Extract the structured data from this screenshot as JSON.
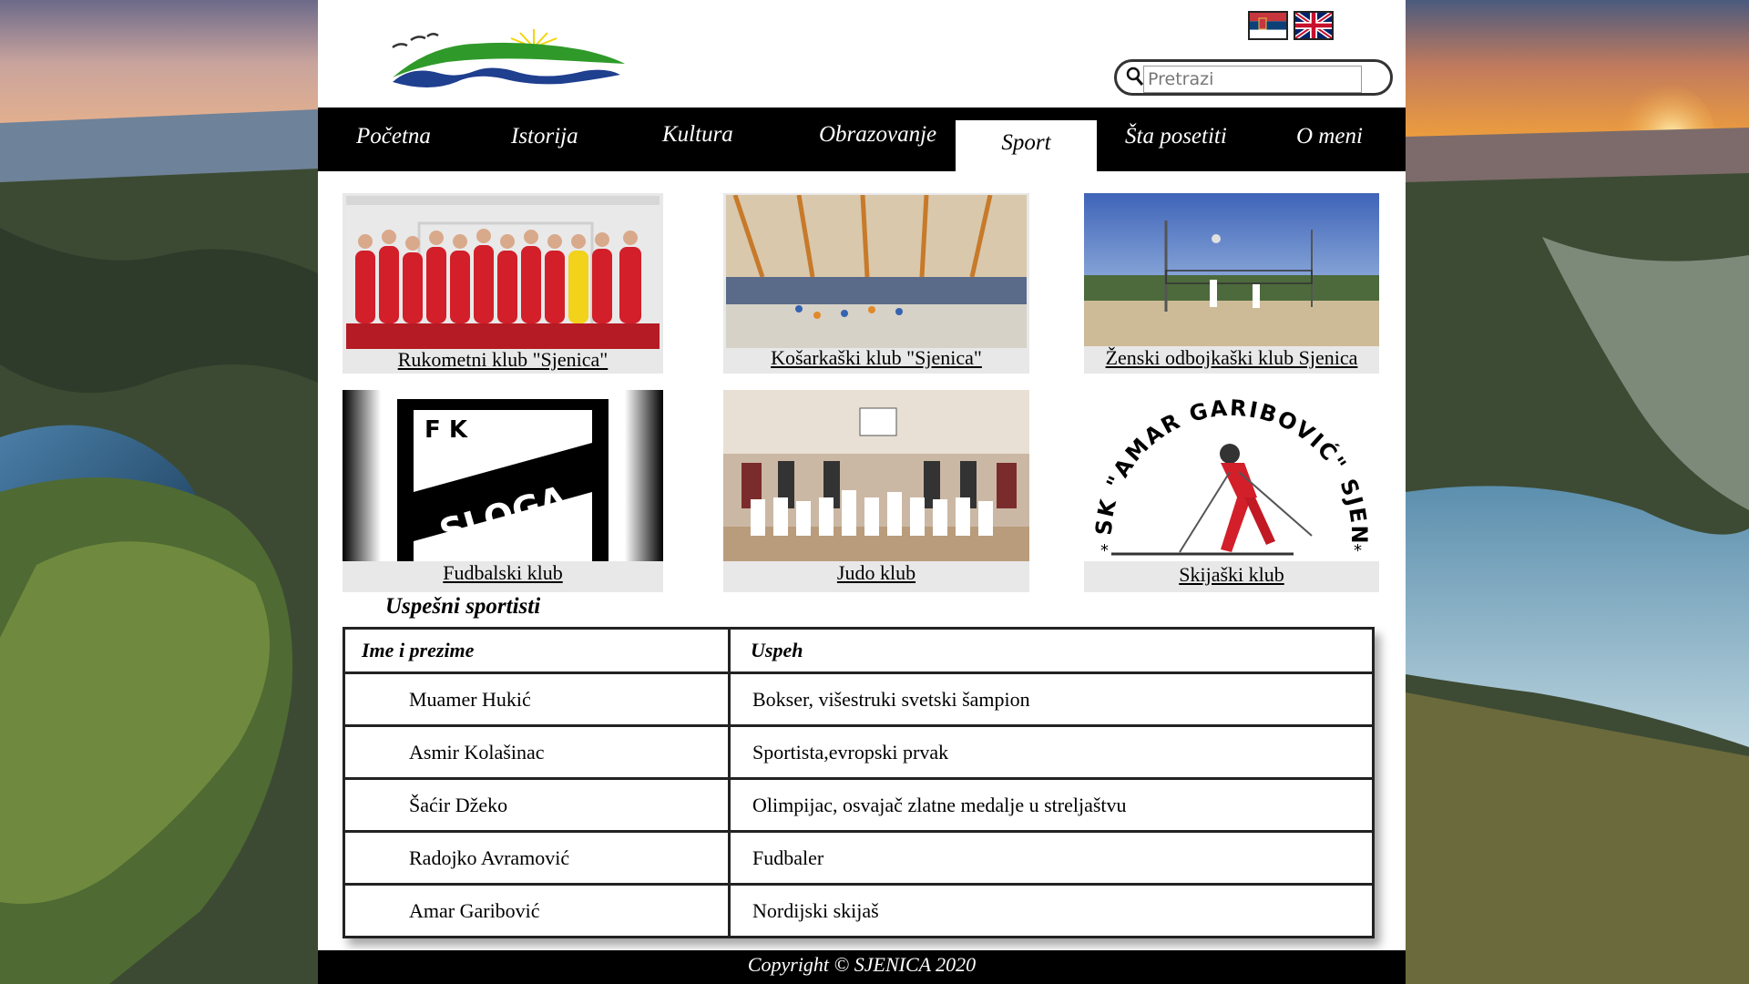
{
  "header": {
    "flags": [
      {
        "name": "serbian-flag-icon",
        "colors": [
          "#c6363c",
          "#0c4076",
          "#ffffff"
        ]
      },
      {
        "name": "uk-flag-icon",
        "colors": [
          "#012169",
          "#ffffff",
          "#c8102e"
        ]
      }
    ],
    "search": {
      "placeholder": "Pretrazi"
    }
  },
  "nav": {
    "items": [
      {
        "label": "Početna"
      },
      {
        "label": "Istorija"
      },
      {
        "label": "Kultura"
      },
      {
        "label": "Obrazovanje"
      },
      {
        "label": "Sport",
        "active": true
      },
      {
        "label": "Šta posetiti"
      },
      {
        "label": "O meni"
      }
    ]
  },
  "clubs": [
    {
      "label": "Rukometni klub \"Sjenica\"",
      "image": "handball-team-photo"
    },
    {
      "label": "Košarkaški klub \"Sjenica\"",
      "image": "sports-hall-photo"
    },
    {
      "label": "Ženski odbojkaški klub Sjenica",
      "image": "beach-volleyball-photo"
    },
    {
      "label": " Fudbalski klub",
      "image": "fk-sloga-logo",
      "logo_text": [
        "F K",
        "SLOGA"
      ]
    },
    {
      "label": " Judo klub",
      "image": "judo-club-photo"
    },
    {
      "label": "Skijaški klub",
      "image": "ski-club-logo",
      "logo_text": "SK \"AMAR GARIBOVIĆ\" SJENICA"
    }
  ],
  "athletes": {
    "title": "Uspešni sportisti",
    "headers": [
      "Ime i prezime",
      "Uspeh"
    ],
    "rows": [
      [
        "Muamer Hukić",
        "Bokser, višestruki svetski šampion"
      ],
      [
        "Asmir Kolašinac",
        "Sportista,evropski prvak"
      ],
      [
        "Šaćir Džeko",
        "Olimpijac, osvajač zlatne medalje u streljaštvu"
      ],
      [
        "Radojko Avramović",
        "Fudbaler"
      ],
      [
        "Amar Garibović",
        "Nordijski skijaš"
      ]
    ]
  },
  "footer": {
    "text": "Copyright © SJENICA 2020"
  },
  "colors": {
    "nav_bg": "#000000",
    "page_bg": "#ffffff",
    "card_bg": "#e8e8e8"
  }
}
